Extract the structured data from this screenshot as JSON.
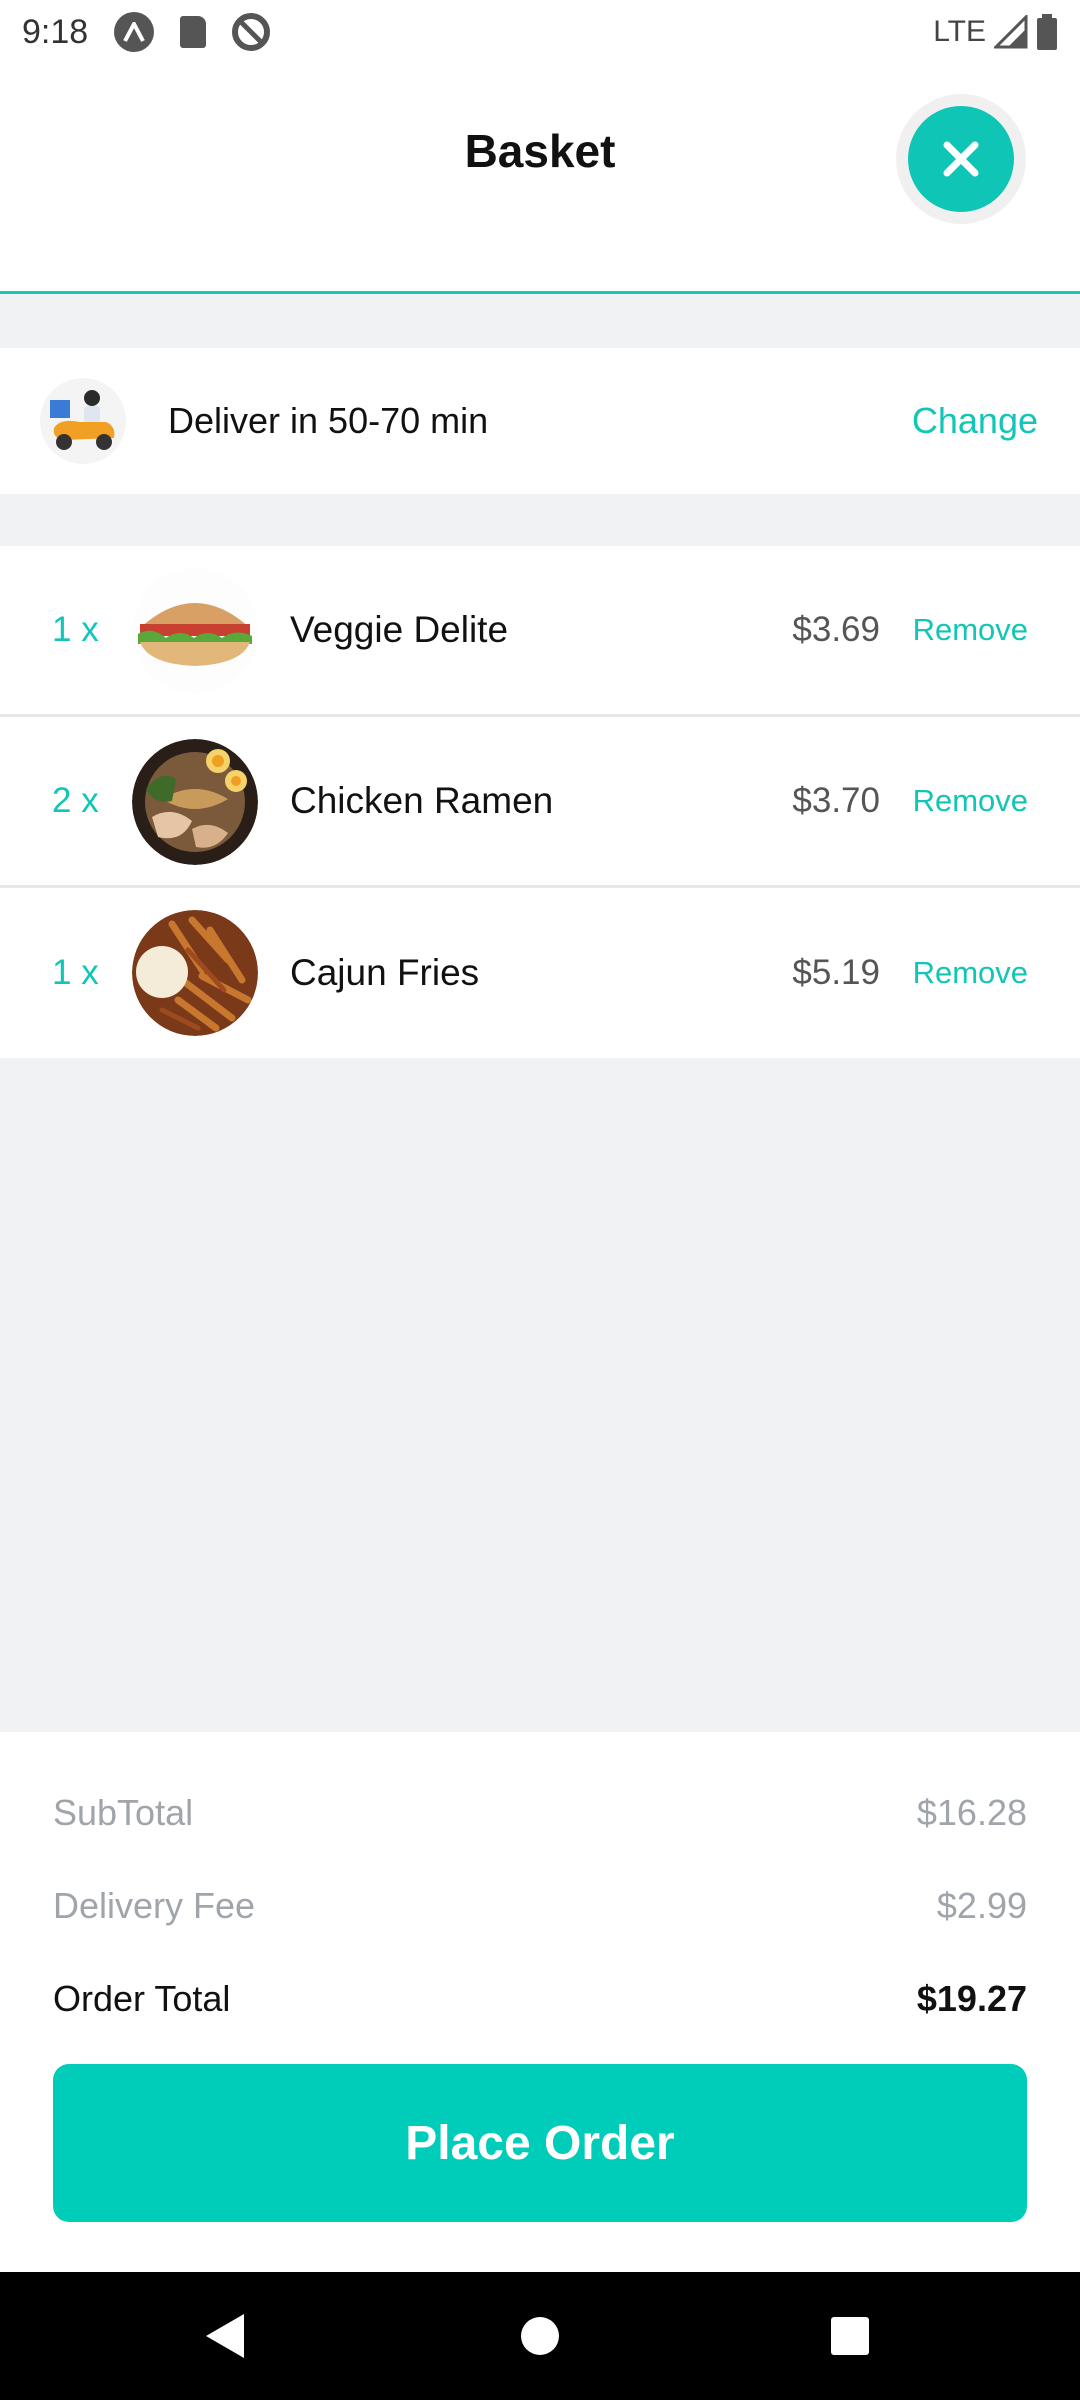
{
  "status_bar": {
    "time": "9:18",
    "network": "LTE",
    "icons": [
      "autofill-icon",
      "sd-card-icon",
      "data-saver-icon",
      "signal-icon",
      "battery-icon"
    ]
  },
  "header": {
    "title": "Basket",
    "close_icon": "close-icon"
  },
  "delivery": {
    "text": "Deliver in 50-70 min",
    "change_label": "Change",
    "icon": "delivery-scooter-icon"
  },
  "items": [
    {
      "qty": "1 x",
      "name": "Veggie Delite",
      "price": "$3.69",
      "remove_label": "Remove",
      "image": "sandwich"
    },
    {
      "qty": "2 x",
      "name": "Chicken Ramen",
      "price": "$3.70",
      "remove_label": "Remove",
      "image": "ramen"
    },
    {
      "qty": "1 x",
      "name": "Cajun Fries",
      "price": "$5.19",
      "remove_label": "Remove",
      "image": "fries"
    }
  ],
  "summary": {
    "subtotal_label": "SubTotal",
    "subtotal_value": "$16.28",
    "delivery_fee_label": "Delivery Fee",
    "delivery_fee_value": "$2.99",
    "order_total_label": "Order Total",
    "order_total_value": "$19.27",
    "place_order_label": "Place Order"
  },
  "colors": {
    "accent": "#0fc6b6",
    "button": "#00cdb9",
    "muted_text": "#a0a4ab",
    "background_grey": "#f1f2f4"
  },
  "nav_bar": {
    "buttons": [
      "back-icon",
      "home-icon",
      "recents-icon"
    ]
  }
}
